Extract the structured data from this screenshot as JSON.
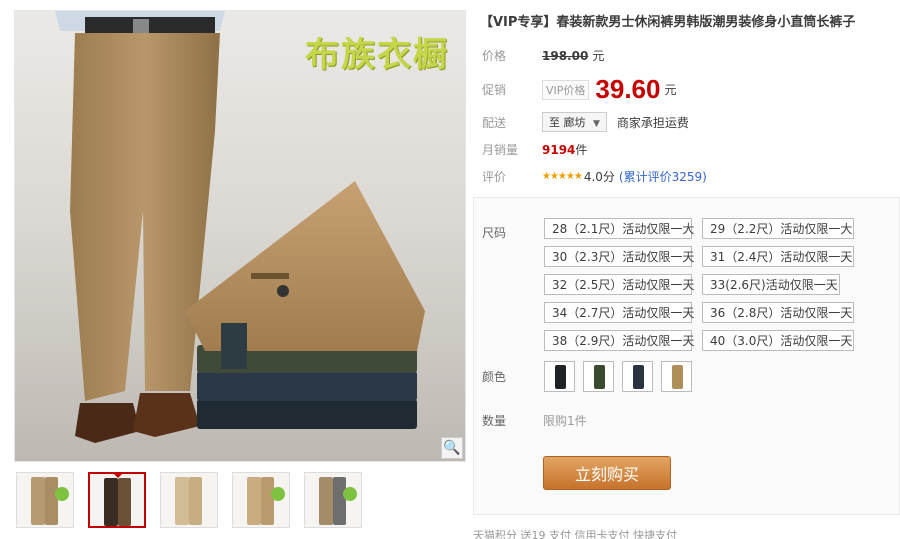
{
  "product": {
    "title": "【VIP专享】春装新款男士休闲裤男韩版潮男装修身小直筒长裤子",
    "brand_watermark": "布族衣橱"
  },
  "price": {
    "label": "价格",
    "original": "198.00",
    "unit": "元"
  },
  "promo": {
    "label": "促销",
    "tag": "VIP价格",
    "price": "39.60",
    "unit": "元"
  },
  "delivery": {
    "label": "配送",
    "to": "至 廊坊",
    "shipping": "商家承担运费"
  },
  "sales": {
    "label": "月销量",
    "count": "9194",
    "unit": "件"
  },
  "rating": {
    "label": "评价",
    "stars": "★★★★★",
    "score": "4.0分",
    "reviews": "(累计评价3259)"
  },
  "sku": {
    "size_label": "尺码",
    "sizes": [
      "28（2.1尺）活动仅限一大",
      "29（2.2尺）活动仅限一大",
      "30（2.3尺）活动仅限一天",
      "31（2.4尺）活动仅限一天",
      "32（2.5尺）活动仅限一天",
      "33(2.6尺)活动仅限一天",
      "34（2.7尺）活动仅限一天",
      "36（2.8尺）活动仅限一天",
      "38（2.9尺）活动仅限一天",
      "40（3.0尺）活动仅限一天"
    ],
    "color_label": "颜色",
    "colors": [
      "#1f2326",
      "#3a4a2e",
      "#2a3340",
      "#b08e5c"
    ],
    "qty_label": "数量",
    "qty_text": "限购1件",
    "buy_label": "立刻购买"
  },
  "bottom": {
    "text": "天猫积分  送19          支付  信用卡支付    快捷支付"
  },
  "colors": {
    "accent": "#c40000",
    "buy_button": "#d88a45"
  }
}
